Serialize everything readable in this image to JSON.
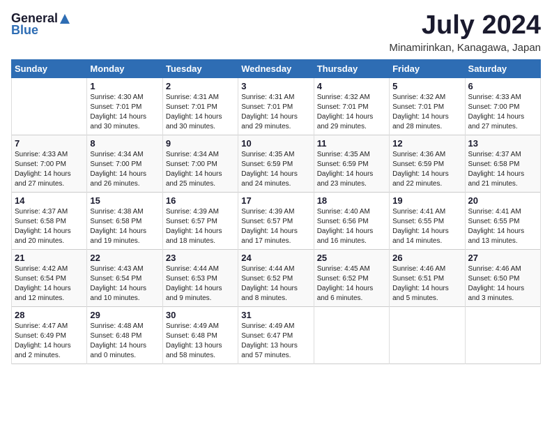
{
  "header": {
    "logo_general": "General",
    "logo_blue": "Blue",
    "month_title": "July 2024",
    "location": "Minamirinkan, Kanagawa, Japan"
  },
  "days_of_week": [
    "Sunday",
    "Monday",
    "Tuesday",
    "Wednesday",
    "Thursday",
    "Friday",
    "Saturday"
  ],
  "weeks": [
    [
      {
        "day": "",
        "sunrise": "",
        "sunset": "",
        "daylight": ""
      },
      {
        "day": "1",
        "sunrise": "4:30 AM",
        "sunset": "7:01 PM",
        "daylight": "14 hours and 30 minutes."
      },
      {
        "day": "2",
        "sunrise": "4:31 AM",
        "sunset": "7:01 PM",
        "daylight": "14 hours and 30 minutes."
      },
      {
        "day": "3",
        "sunrise": "4:31 AM",
        "sunset": "7:01 PM",
        "daylight": "14 hours and 29 minutes."
      },
      {
        "day": "4",
        "sunrise": "4:32 AM",
        "sunset": "7:01 PM",
        "daylight": "14 hours and 29 minutes."
      },
      {
        "day": "5",
        "sunrise": "4:32 AM",
        "sunset": "7:01 PM",
        "daylight": "14 hours and 28 minutes."
      },
      {
        "day": "6",
        "sunrise": "4:33 AM",
        "sunset": "7:00 PM",
        "daylight": "14 hours and 27 minutes."
      }
    ],
    [
      {
        "day": "7",
        "sunrise": "4:33 AM",
        "sunset": "7:00 PM",
        "daylight": "14 hours and 27 minutes."
      },
      {
        "day": "8",
        "sunrise": "4:34 AM",
        "sunset": "7:00 PM",
        "daylight": "14 hours and 26 minutes."
      },
      {
        "day": "9",
        "sunrise": "4:34 AM",
        "sunset": "7:00 PM",
        "daylight": "14 hours and 25 minutes."
      },
      {
        "day": "10",
        "sunrise": "4:35 AM",
        "sunset": "6:59 PM",
        "daylight": "14 hours and 24 minutes."
      },
      {
        "day": "11",
        "sunrise": "4:35 AM",
        "sunset": "6:59 PM",
        "daylight": "14 hours and 23 minutes."
      },
      {
        "day": "12",
        "sunrise": "4:36 AM",
        "sunset": "6:59 PM",
        "daylight": "14 hours and 22 minutes."
      },
      {
        "day": "13",
        "sunrise": "4:37 AM",
        "sunset": "6:58 PM",
        "daylight": "14 hours and 21 minutes."
      }
    ],
    [
      {
        "day": "14",
        "sunrise": "4:37 AM",
        "sunset": "6:58 PM",
        "daylight": "14 hours and 20 minutes."
      },
      {
        "day": "15",
        "sunrise": "4:38 AM",
        "sunset": "6:58 PM",
        "daylight": "14 hours and 19 minutes."
      },
      {
        "day": "16",
        "sunrise": "4:39 AM",
        "sunset": "6:57 PM",
        "daylight": "14 hours and 18 minutes."
      },
      {
        "day": "17",
        "sunrise": "4:39 AM",
        "sunset": "6:57 PM",
        "daylight": "14 hours and 17 minutes."
      },
      {
        "day": "18",
        "sunrise": "4:40 AM",
        "sunset": "6:56 PM",
        "daylight": "14 hours and 16 minutes."
      },
      {
        "day": "19",
        "sunrise": "4:41 AM",
        "sunset": "6:55 PM",
        "daylight": "14 hours and 14 minutes."
      },
      {
        "day": "20",
        "sunrise": "4:41 AM",
        "sunset": "6:55 PM",
        "daylight": "14 hours and 13 minutes."
      }
    ],
    [
      {
        "day": "21",
        "sunrise": "4:42 AM",
        "sunset": "6:54 PM",
        "daylight": "14 hours and 12 minutes."
      },
      {
        "day": "22",
        "sunrise": "4:43 AM",
        "sunset": "6:54 PM",
        "daylight": "14 hours and 10 minutes."
      },
      {
        "day": "23",
        "sunrise": "4:44 AM",
        "sunset": "6:53 PM",
        "daylight": "14 hours and 9 minutes."
      },
      {
        "day": "24",
        "sunrise": "4:44 AM",
        "sunset": "6:52 PM",
        "daylight": "14 hours and 8 minutes."
      },
      {
        "day": "25",
        "sunrise": "4:45 AM",
        "sunset": "6:52 PM",
        "daylight": "14 hours and 6 minutes."
      },
      {
        "day": "26",
        "sunrise": "4:46 AM",
        "sunset": "6:51 PM",
        "daylight": "14 hours and 5 minutes."
      },
      {
        "day": "27",
        "sunrise": "4:46 AM",
        "sunset": "6:50 PM",
        "daylight": "14 hours and 3 minutes."
      }
    ],
    [
      {
        "day": "28",
        "sunrise": "4:47 AM",
        "sunset": "6:49 PM",
        "daylight": "14 hours and 2 minutes."
      },
      {
        "day": "29",
        "sunrise": "4:48 AM",
        "sunset": "6:48 PM",
        "daylight": "14 hours and 0 minutes."
      },
      {
        "day": "30",
        "sunrise": "4:49 AM",
        "sunset": "6:48 PM",
        "daylight": "13 hours and 58 minutes."
      },
      {
        "day": "31",
        "sunrise": "4:49 AM",
        "sunset": "6:47 PM",
        "daylight": "13 hours and 57 minutes."
      },
      {
        "day": "",
        "sunrise": "",
        "sunset": "",
        "daylight": ""
      },
      {
        "day": "",
        "sunrise": "",
        "sunset": "",
        "daylight": ""
      },
      {
        "day": "",
        "sunrise": "",
        "sunset": "",
        "daylight": ""
      }
    ]
  ],
  "labels": {
    "sunrise_prefix": "Sunrise: ",
    "sunset_prefix": "Sunset: ",
    "daylight_prefix": "Daylight: "
  }
}
